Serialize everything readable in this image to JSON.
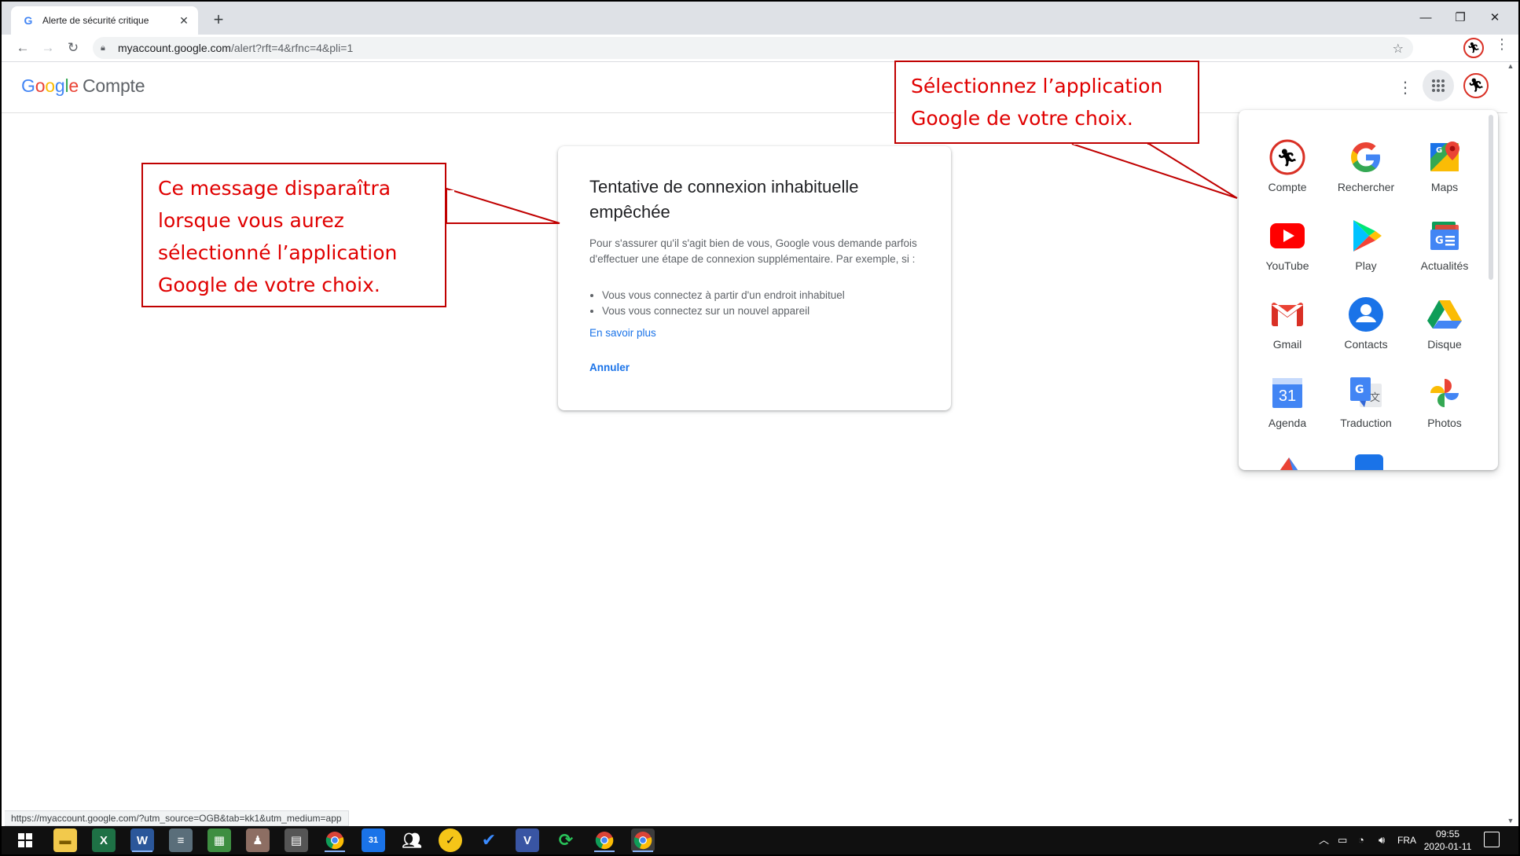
{
  "browser": {
    "tab_title": "Alerte de sécurité critique",
    "tab_favicon": "G",
    "tab_close": "✕",
    "new_tab": "+",
    "window": {
      "minimize": "—",
      "restore": "❐",
      "close": "✕"
    },
    "url_host": "myaccount.google.com",
    "url_rest": "/alert?rft=4&rfnc=4&pli=1"
  },
  "header": {
    "logo": {
      "G": "G",
      "o1": "o",
      "o2": "o",
      "g": "g",
      "l": "l",
      "e": "e"
    },
    "product": "Compte"
  },
  "card": {
    "title": "Tentative de connexion inhabituelle empêchée",
    "intro": "Pour s'assurer qu'il s'agit bien de vous, Google vous demande parfois d'effectuer une étape de connexion supplémentaire. Par exemple, si :",
    "bullets": [
      "Vous vous connectez à partir d'un endroit inhabituel",
      "Vous vous connectez sur un nouvel appareil"
    ],
    "learn_more": "En savoir plus",
    "cancel": "Annuler"
  },
  "apps": [
    {
      "label": "Compte",
      "icon": "account-icon"
    },
    {
      "label": "Rechercher",
      "icon": "google-search-icon"
    },
    {
      "label": "Maps",
      "icon": "maps-icon"
    },
    {
      "label": "YouTube",
      "icon": "youtube-icon"
    },
    {
      "label": "Play",
      "icon": "play-store-icon"
    },
    {
      "label": "Actualités",
      "icon": "news-icon"
    },
    {
      "label": "Gmail",
      "icon": "gmail-icon"
    },
    {
      "label": "Contacts",
      "icon": "contacts-icon"
    },
    {
      "label": "Disque",
      "icon": "drive-icon"
    },
    {
      "label": "Agenda",
      "icon": "calendar-icon",
      "day": "31"
    },
    {
      "label": "Traduction",
      "icon": "translate-icon"
    },
    {
      "label": "Photos",
      "icon": "photos-icon"
    }
  ],
  "callouts": {
    "left_lines": [
      "Ce message disparaîtra",
      "lorsque vous aurez",
      "sélectionné l’application",
      "Google de votre choix."
    ],
    "right_lines": [
      "Sélectionnez l’application",
      "Google de votre choix."
    ]
  },
  "status_url": "https://myaccount.google.com/?utm_source=OGB&tab=kk1&utm_medium=app",
  "taskbar": {
    "apps": [
      "file-explorer-icon",
      "excel-icon",
      "word-icon",
      "notes-icon",
      "spreadsheet-icon",
      "pdf-app-icon",
      "calculator-icon",
      "chrome-icon",
      "calendar-app-icon",
      "people-icon",
      "norton-icon",
      "todo-icon",
      "visio-icon",
      "sync-icon",
      "chrome-profile-icon",
      "chrome-active-icon"
    ],
    "calendar_day": "31",
    "language": "FRA",
    "time": "09:55",
    "date": "2020-01-11"
  },
  "colors": {
    "callout_red": "#e00000",
    "link_blue": "#1a73e8",
    "taskbar": "#101010"
  }
}
